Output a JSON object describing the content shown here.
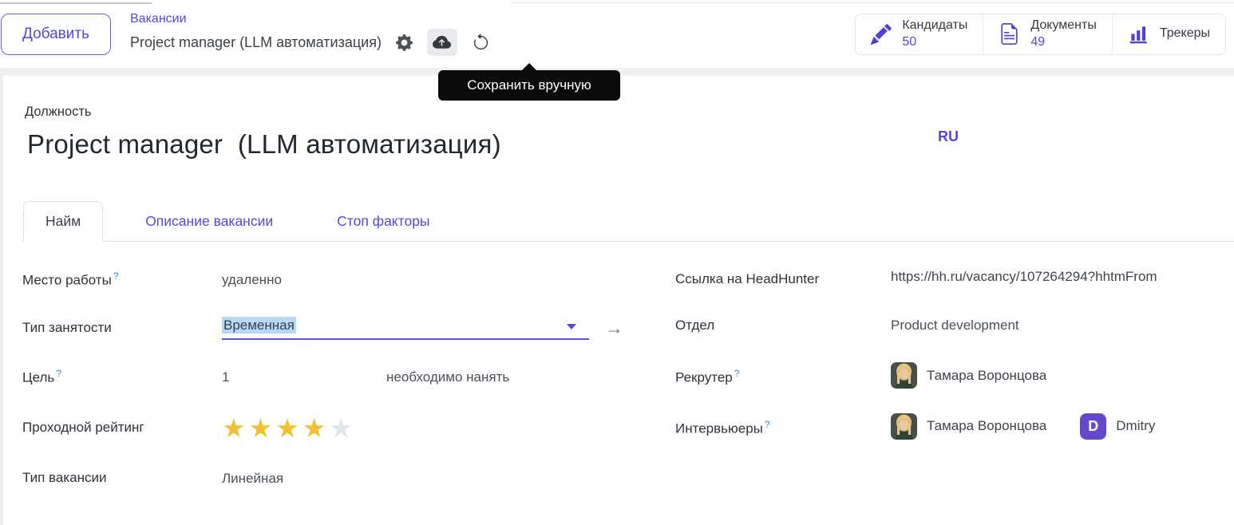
{
  "colors": {
    "accent": "#5348DB",
    "badge": "#6648CE",
    "star_gold": "#EFC133",
    "star_empty": "#E1E4E8",
    "selection_highlight": "#B8D8FA",
    "tooltip_bg": "#0B0B0C"
  },
  "header": {
    "add_button": "Добавить",
    "breadcrumb": {
      "parent": "Вакансии",
      "current": "Project manager (LLM автоматизация)"
    },
    "icons": {
      "settings": "gear-icon",
      "save": "cloud-upload-icon",
      "discard": "undo-icon"
    },
    "tooltip": "Сохранить вручную",
    "stat_buttons": [
      {
        "icon": "pencil-icon",
        "label": "Кандидаты",
        "count": "50"
      },
      {
        "icon": "document-icon",
        "label": "Документы",
        "count": "49"
      },
      {
        "icon": "bar-chart-icon",
        "label": "Трекеры",
        "count": ""
      }
    ]
  },
  "sheet": {
    "position_label": "Должность",
    "title": "Project manager  (LLM автоматизация)",
    "language": "RU",
    "tabs": [
      {
        "label": "Найм",
        "active": true
      },
      {
        "label": "Описание вакансии",
        "active": false
      },
      {
        "label": "Стоп факторы",
        "active": false
      }
    ],
    "left_fields": {
      "workplace": {
        "label": "Место работы",
        "help": "?",
        "value": "удаленно"
      },
      "employment_type": {
        "label": "Тип занятости",
        "value": "Временная"
      },
      "target": {
        "label": "Цель",
        "help": "?",
        "value": "1",
        "suffix": "необходимо нанять"
      },
      "rating": {
        "label": "Проходной рейтинг",
        "stars_filled": 4,
        "stars_total": 5
      },
      "vacancy_type": {
        "label": "Тип вакансии",
        "value": "Линейная"
      }
    },
    "right_fields": {
      "hh_link": {
        "label": "Ссылка на HeadHunter",
        "value": "https://hh.ru/vacancy/107264294?hhtmFrom"
      },
      "department": {
        "label": "Отдел",
        "value": "Product development"
      },
      "recruiter": {
        "label": "Рекрутер",
        "help": "?",
        "name": "Тамара Воронцова"
      },
      "interviewers": {
        "label": "Интервьюеры",
        "help": "?",
        "people": [
          {
            "name": "Тамара Воронцова",
            "avatar": "photo"
          },
          {
            "name": "Dmitry",
            "initial": "D"
          }
        ]
      }
    }
  }
}
